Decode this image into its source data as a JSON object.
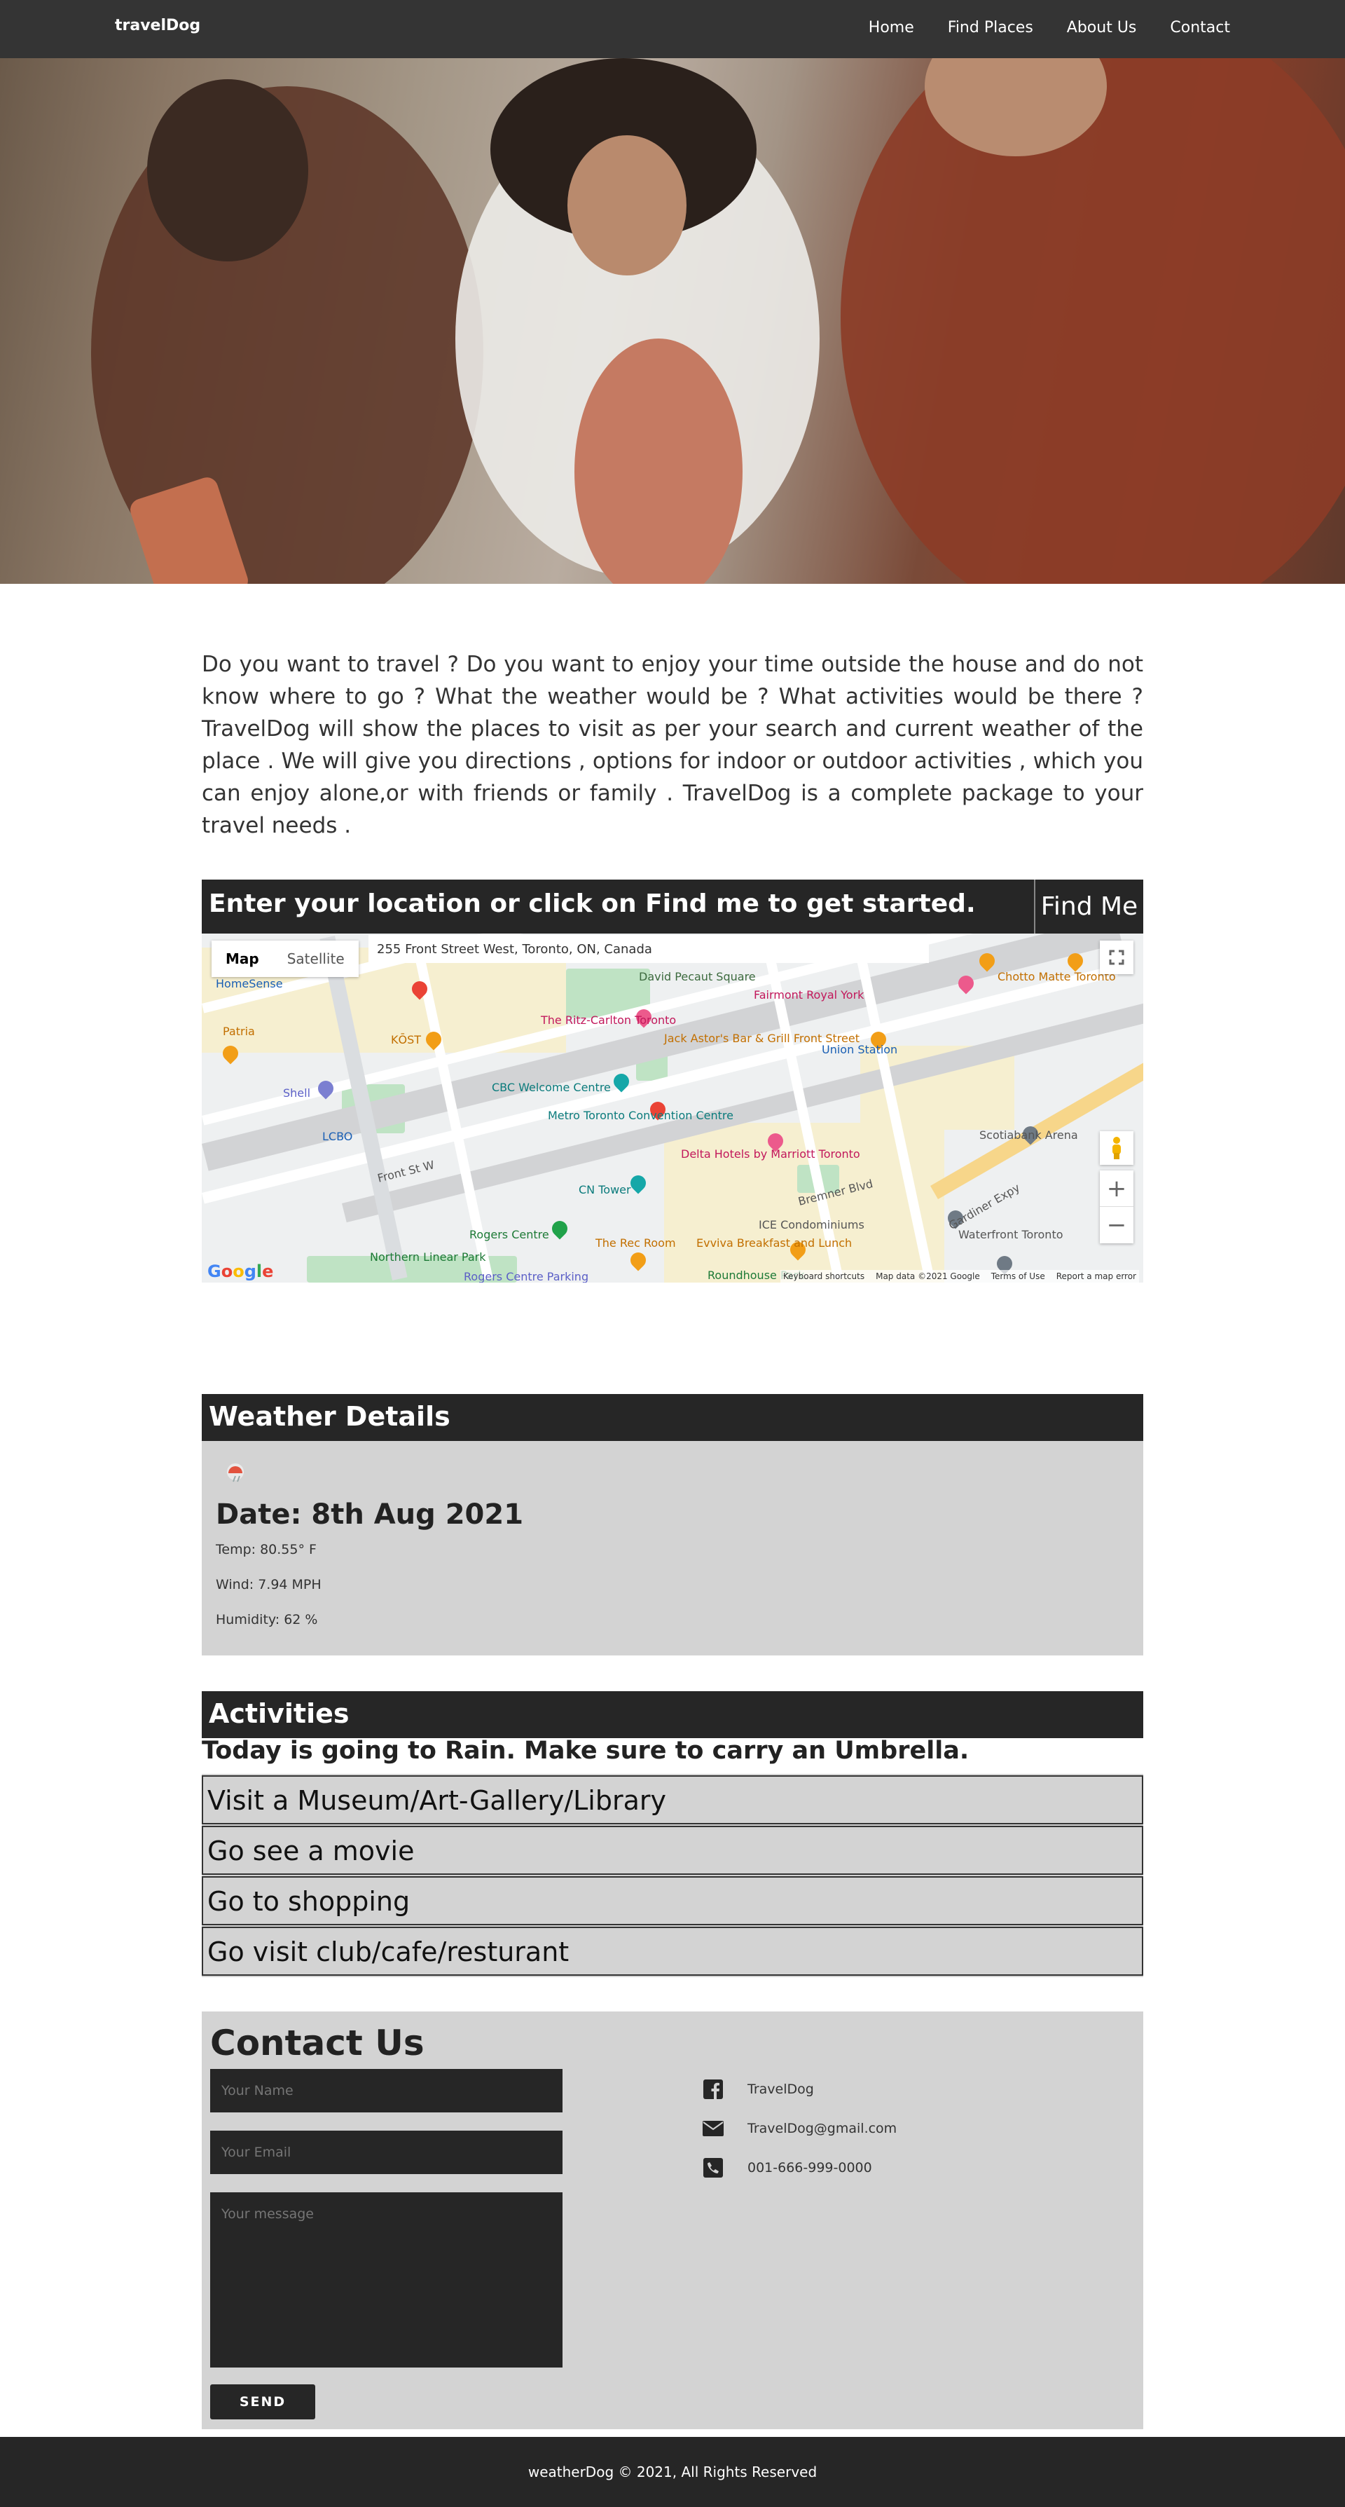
{
  "nav": {
    "brand": "travelDog",
    "links": [
      "Home",
      "Find Places",
      "About Us",
      "Contact"
    ]
  },
  "intro": "Do you want to travel ? Do you want to enjoy your time outside the house and do not know where to go ? What the weather would be ? What activities would be there ? TravelDog will show the places to visit as per your search and current weather of the place . We will give you directions , options for indoor or outdoor activities , which you can enjoy alone,or with friends or family . TravelDog is a complete package to your travel needs .",
  "location": {
    "prompt": "Enter your location or click on Find me to get started.",
    "button": "Find Me"
  },
  "map": {
    "tabs": [
      "Map",
      "Satellite"
    ],
    "address": "255 Front Street West, Toronto, ON, Canada",
    "pois": [
      "David Pecaut Square",
      "Fairmont Royal York",
      "The Ritz-Carlton Toronto",
      "Jack Astor's Bar & Grill Front Street",
      "Union Station",
      "CBC Welcome Centre",
      "Metro Toronto Convention Centre",
      "Delta Hotels by Marriott Toronto",
      "CN Tower",
      "Rogers Centre",
      "The Rec Room",
      "Evviva Breakfast and Lunch",
      "ICE Condominiums",
      "Scotiabank Arena",
      "Waterfront Toronto",
      "Gardiner Expy",
      "Bremner Blvd",
      "Front St W",
      "KŌST",
      "Patria",
      "Shell",
      "LCBO",
      "Chotto Matte Toronto",
      "Roundhouse Park",
      "Northern Linear Park",
      "Rogers Centre Parking",
      "HomeSense"
    ],
    "footer": [
      "Keyboard shortcuts",
      "Map data ©2021 Google",
      "Terms of Use",
      "Report a map error"
    ],
    "logo": "Google"
  },
  "weather": {
    "heading": "Weather Details",
    "date": "Date: 8th Aug 2021",
    "temp": "Temp: 80.55° F",
    "wind": "Wind: 7.94 MPH",
    "humidity": "Humidity: 62 %"
  },
  "activities": {
    "heading": "Activities",
    "message": "Today is going to Rain. Make sure to carry an Umbrella.",
    "items": [
      "Visit a Museum/Art-Gallery/Library",
      "Go see a movie",
      "Go to shopping",
      "Go visit club/cafe/resturant"
    ]
  },
  "contact": {
    "title": "Contact Us",
    "name_placeholder": "Your Name",
    "email_placeholder": "Your Email",
    "message_placeholder": "Your message",
    "send": "SEND",
    "facebook": "TravelDog",
    "email": "TravelDog@gmail.com",
    "phone": "001-666-999-0000"
  },
  "footer": "weatherDog © 2021, All Rights Reserved",
  "colors": {
    "dark": "#262626",
    "panel": "#d3d3d3",
    "nav": "#343434"
  }
}
